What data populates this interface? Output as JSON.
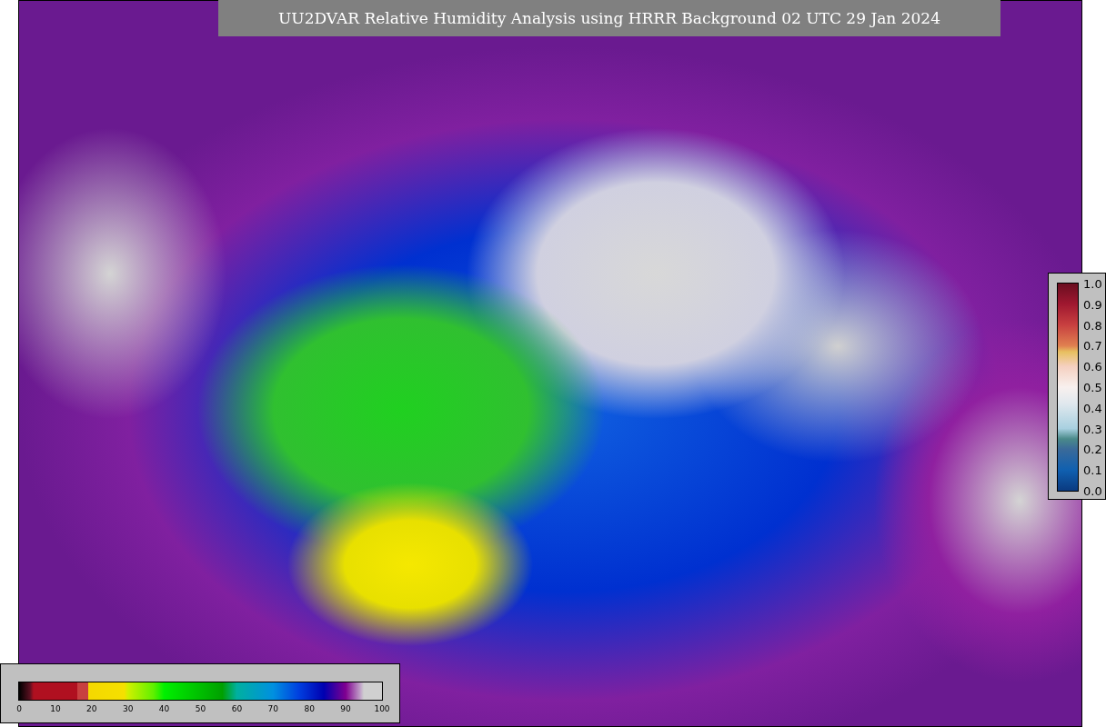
{
  "title": "UU2DVAR Relative Humidity Analysis using HRRR Background 02 UTC 29 Jan 2024",
  "humidity_colorbar": {
    "ticks": [
      "0",
      "10",
      "20",
      "30",
      "40",
      "50",
      "60",
      "70",
      "80",
      "90",
      "100"
    ]
  },
  "station_colorbar": {
    "ticks": [
      "1.0",
      "0.9",
      "0.8",
      "0.7",
      "0.6",
      "0.5",
      "0.4",
      "0.3",
      "0.2",
      "0.1",
      "0.0"
    ]
  }
}
